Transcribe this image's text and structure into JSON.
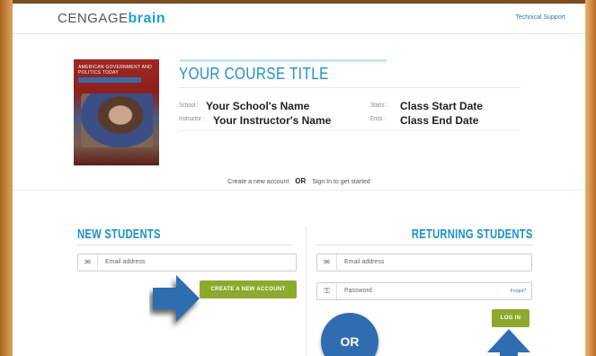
{
  "header": {
    "logo_part1": "CENGAGE",
    "logo_part2": "brain",
    "technical_support": "Technical Support"
  },
  "course": {
    "book_cover_title": "AMERICAN GOVERNMENT AND POLITICS TODAY",
    "title": "YOUR COURSE TITLE",
    "school_label": "School :",
    "school_value": "Your School's Name",
    "instructor_label": "Instructor :",
    "instructor_value": "Your Instructor's Name",
    "starts_label": "Starts :",
    "starts_value": "Class Start Date",
    "ends_label": "Ends :",
    "ends_value": "Class End Date"
  },
  "prompt": {
    "create_text": "Create a new account",
    "or_text": "OR",
    "sign_in_text": "Sign In to get started"
  },
  "new_students": {
    "heading": "NEW STUDENTS",
    "email_placeholder": "Email address",
    "create_button": "CREATE A NEW ACCOUNT"
  },
  "returning_students": {
    "heading": "RETURNING STUDENTS",
    "email_placeholder": "Email address",
    "password_placeholder": "Password",
    "forgot_link": "Forgot?",
    "login_button": "LOG IN"
  },
  "overlay": {
    "or_badge": "OR"
  },
  "colors": {
    "accent_blue": "#1e8fc8",
    "button_green": "#8fa82e",
    "badge_blue": "#2f6db0",
    "frame_orange": "#c9863a"
  }
}
